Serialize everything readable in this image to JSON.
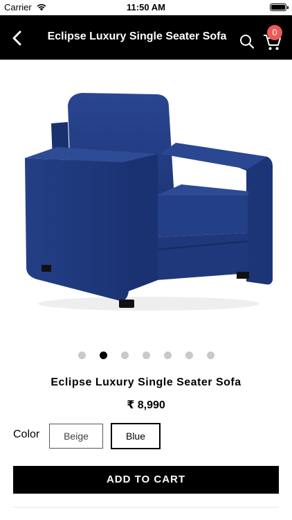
{
  "status_bar": {
    "carrier": "Carrier",
    "time": "11:50 AM"
  },
  "nav": {
    "title": "Eclipse Luxury Single Seater Sofa",
    "cart_count": "0",
    "badge_color": "#ec5a57"
  },
  "product": {
    "name": "Eclipse Luxury Single Seater Sofa",
    "price": "₹ 8,990",
    "image_count": 7,
    "active_image_index": 1
  },
  "color_selector": {
    "label": "Color",
    "options": [
      {
        "label": "Beige",
        "selected": false
      },
      {
        "label": "Blue",
        "selected": true
      }
    ]
  },
  "actions": {
    "add_to_cart": "ADD TO CART"
  },
  "colors": {
    "nav_background": "#000000",
    "sofa_blue": "#1f3a7a"
  }
}
